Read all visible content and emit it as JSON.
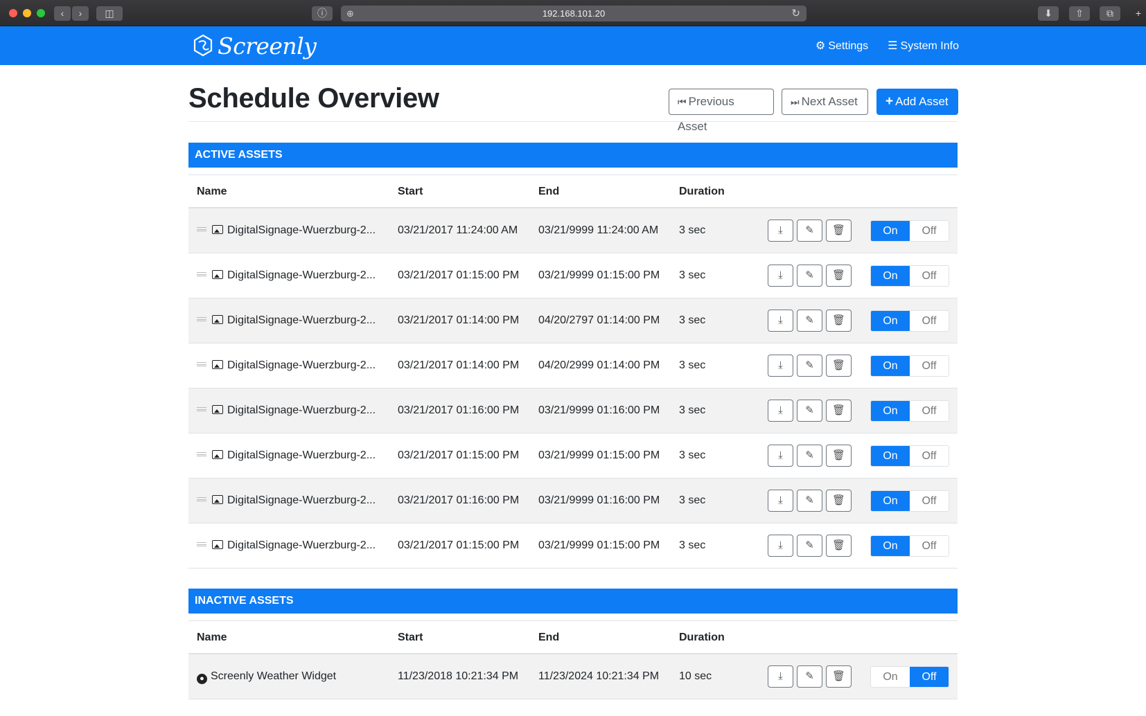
{
  "browser": {
    "url": "192.168.101.20",
    "reload_icon": "reload-icon",
    "info_icon": "info-icon"
  },
  "navbar": {
    "brand": "Screenly",
    "settings_label": "Settings",
    "sysinfo_label": "System Info"
  },
  "page": {
    "title": "Schedule Overview",
    "prev_label": "Previous Asset",
    "next_label": "Next Asset",
    "add_label": "Add Asset"
  },
  "columns": {
    "name": "Name",
    "start": "Start",
    "end": "End",
    "duration": "Duration"
  },
  "active": {
    "heading": "ACTIVE ASSETS",
    "rows": [
      {
        "name": "DigitalSignage-Wuerzburg-2...",
        "start": "03/21/2017 11:24:00 AM",
        "end": "03/21/9999 11:24:00 AM",
        "duration": "3 sec"
      },
      {
        "name": "DigitalSignage-Wuerzburg-2...",
        "start": "03/21/2017 01:15:00 PM",
        "end": "03/21/9999 01:15:00 PM",
        "duration": "3 sec"
      },
      {
        "name": "DigitalSignage-Wuerzburg-2...",
        "start": "03/21/2017 01:14:00 PM",
        "end": "04/20/2797 01:14:00 PM",
        "duration": "3 sec"
      },
      {
        "name": "DigitalSignage-Wuerzburg-2...",
        "start": "03/21/2017 01:14:00 PM",
        "end": "04/20/2999 01:14:00 PM",
        "duration": "3 sec"
      },
      {
        "name": "DigitalSignage-Wuerzburg-2...",
        "start": "03/21/2017 01:16:00 PM",
        "end": "03/21/9999 01:16:00 PM",
        "duration": "3 sec"
      },
      {
        "name": "DigitalSignage-Wuerzburg-2...",
        "start": "03/21/2017 01:15:00 PM",
        "end": "03/21/9999 01:15:00 PM",
        "duration": "3 sec"
      },
      {
        "name": "DigitalSignage-Wuerzburg-2...",
        "start": "03/21/2017 01:16:00 PM",
        "end": "03/21/9999 01:16:00 PM",
        "duration": "3 sec"
      },
      {
        "name": "DigitalSignage-Wuerzburg-2...",
        "start": "03/21/2017 01:15:00 PM",
        "end": "03/21/9999 01:15:00 PM",
        "duration": "3 sec"
      }
    ]
  },
  "inactive": {
    "heading": "INACTIVE ASSETS",
    "rows": [
      {
        "name": "Screenly Weather Widget",
        "start": "11/23/2018 10:21:34 PM",
        "end": "11/23/2024 10:21:34 PM",
        "duration": "10 sec"
      }
    ]
  },
  "toggle": {
    "on": "On",
    "off": "Off"
  },
  "colors": {
    "brand": "#0e7cf5",
    "stripe": "#f2f2f2"
  }
}
